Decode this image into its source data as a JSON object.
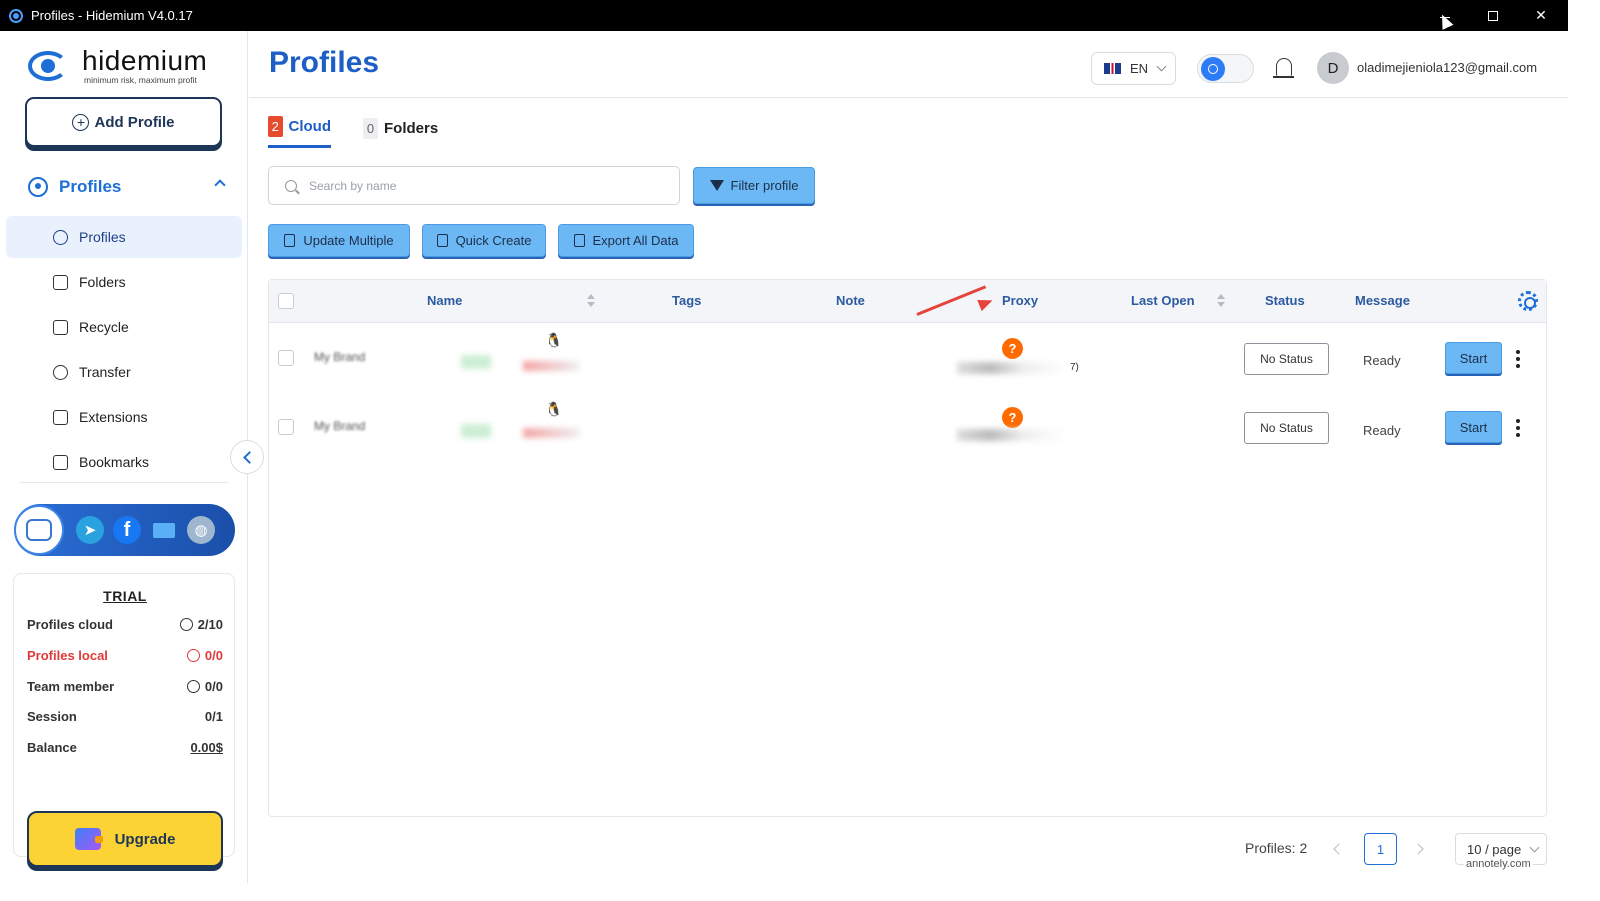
{
  "window": {
    "title": "Profiles - Hidemium V4.0.17"
  },
  "sidebar": {
    "brand": "hidemium",
    "slogan": "minimum risk, maximum profit",
    "add_profile_label": "Add Profile",
    "group_label": "Profiles",
    "items": [
      {
        "label": "Profiles",
        "icon": "user-circle-icon",
        "active": true
      },
      {
        "label": "Folders",
        "icon": "folder-icon",
        "active": false
      },
      {
        "label": "Recycle",
        "icon": "recycle-bin-icon",
        "active": false
      },
      {
        "label": "Transfer",
        "icon": "transfer-icon",
        "active": false
      },
      {
        "label": "Extensions",
        "icon": "extension-icon",
        "active": false
      },
      {
        "label": "Bookmarks",
        "icon": "book-icon",
        "active": false
      }
    ],
    "social": [
      "support-agent-icon",
      "telegram-icon",
      "facebook-icon",
      "mail-icon",
      "globe-icon"
    ],
    "trial": {
      "title": "TRIAL",
      "rows": [
        {
          "label": "Profiles cloud",
          "value": "2/10"
        },
        {
          "label": "Profiles local",
          "value": "0/0"
        },
        {
          "label": "Team member",
          "value": "0/0"
        },
        {
          "label": "Session",
          "value": "0/1"
        },
        {
          "label": "Balance",
          "value": "0.00$"
        }
      ],
      "upgrade_label": "Upgrade"
    }
  },
  "header": {
    "title": "Profiles",
    "language": "EN",
    "avatar_letter": "D",
    "email": "oladimejieniola123@gmail.com"
  },
  "tabs": [
    {
      "count": "2",
      "label": "Cloud",
      "active": true
    },
    {
      "count": "0",
      "label": "Folders",
      "active": false
    }
  ],
  "search": {
    "placeholder": "Search by name",
    "value": ""
  },
  "toolbar": {
    "filter_label": "Filter profile",
    "update_multiple_label": "Update Multiple",
    "quick_create_label": "Quick Create",
    "export_label": "Export All Data"
  },
  "table": {
    "columns": [
      "Name",
      "Tags",
      "Note",
      "Proxy",
      "Last Open",
      "Status",
      "Message"
    ],
    "rows": [
      {
        "name": "My Brand",
        "os_icon": "linux-icon",
        "proxy_tail": "7)",
        "status": "No Status",
        "message": "Ready",
        "action": "Start"
      },
      {
        "name": "My Brand",
        "os_icon": "linux-icon",
        "proxy_tail": "",
        "status": "No Status",
        "message": "Ready",
        "action": "Start"
      }
    ]
  },
  "pagination": {
    "total_label": "Profiles: 2",
    "current_page": "1",
    "page_size": "10 / page"
  },
  "watermark": "annotely.com",
  "colors": {
    "accent": "#1d6fd6",
    "button_blue": "#6cb8f5",
    "upgrade_yellow": "#fbd335",
    "danger": "#e03a3a",
    "proxy_warning": "#ff6a00"
  }
}
